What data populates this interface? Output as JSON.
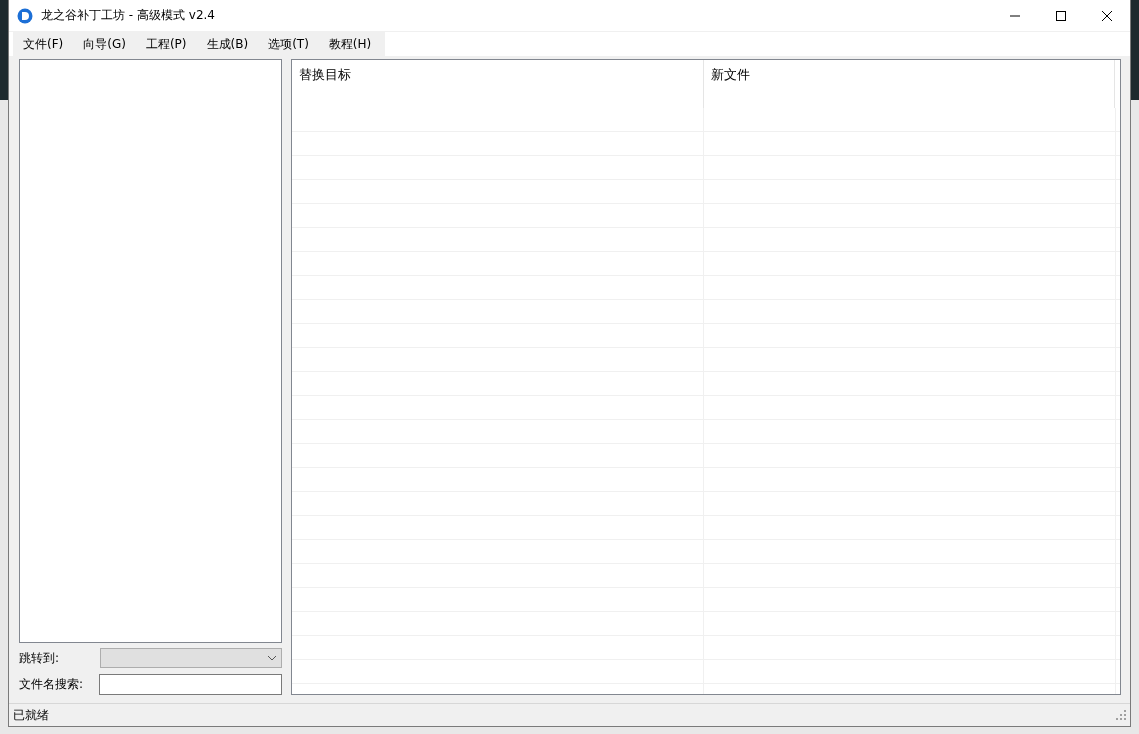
{
  "window": {
    "title": "龙之谷补丁工坊 - 高级模式 v2.4"
  },
  "menu": [
    "文件(F)",
    "向导(G)",
    "工程(P)",
    "生成(B)",
    "选项(T)",
    "教程(H)"
  ],
  "sidebar": {
    "jump_to": {
      "label": "跳转到:",
      "disabled": true
    },
    "search": {
      "label": "文件名搜索:"
    }
  },
  "table": {
    "columns": [
      "替换目标",
      "新文件"
    ]
  },
  "status_bar": "已就绪"
}
